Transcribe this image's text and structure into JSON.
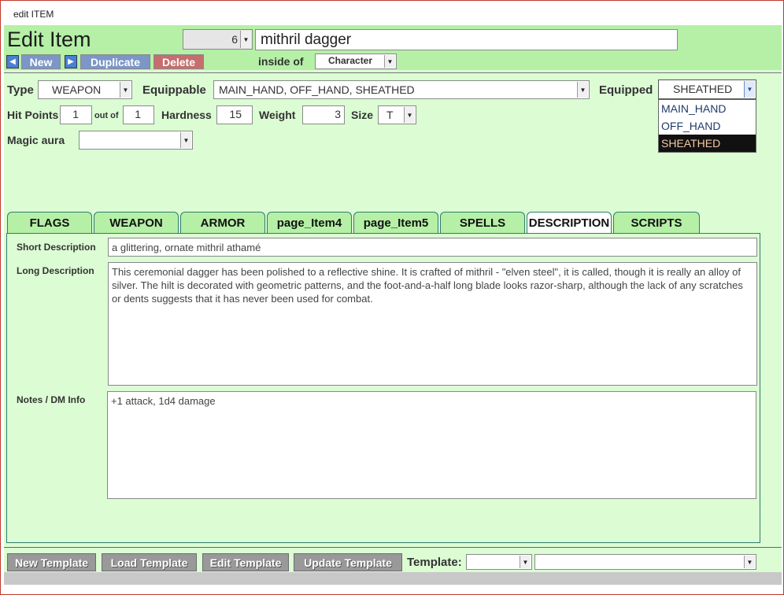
{
  "window": {
    "title": "edit ITEM"
  },
  "header": {
    "title": "Edit Item",
    "record_number": "6",
    "item_name": "mithril dagger",
    "new_label": "New",
    "duplicate_label": "Duplicate",
    "delete_label": "Delete",
    "inside_of_label": "inside of",
    "inside_of_value": "Character"
  },
  "fields": {
    "type_label": "Type",
    "type_value": "WEAPON",
    "equippable_label": "Equippable",
    "equippable_value": "MAIN_HAND, OFF_HAND, SHEATHED",
    "equipped_label": "Equipped",
    "equipped_value": "SHEATHED",
    "equipped_options": [
      "MAIN_HAND",
      "OFF_HAND",
      "SHEATHED"
    ],
    "hit_points_label": "Hit Points",
    "hit_points_value": "1",
    "out_of_label": "out of",
    "hit_points_max": "1",
    "hardness_label": "Hardness",
    "hardness_value": "15",
    "weight_label": "Weight",
    "weight_value": "3",
    "size_label": "Size",
    "size_value": "T",
    "magic_aura_label": "Magic aura",
    "magic_aura_value": ""
  },
  "tabs": [
    "FLAGS",
    "WEAPON",
    "ARMOR",
    "page_Item4",
    "page_Item5",
    "SPELLS",
    "DESCRIPTION",
    "SCRIPTS"
  ],
  "active_tab": "DESCRIPTION",
  "description": {
    "short_label": "Short Description",
    "short_value": "a glittering, ornate mithril athamé",
    "long_label": "Long Description",
    "long_value": "This ceremonial dagger has been polished to a reflective shine. It is crafted of mithril - \"elven steel\", it is called, though it is really an alloy of silver. The hilt is decorated with geometric patterns, and the foot-and-a-half long blade looks razor-sharp, although the lack of any scratches or dents suggests that it has never been used for combat.",
    "notes_label": "Notes / DM Info",
    "notes_value": "+1 attack, 1d4 damage"
  },
  "footer": {
    "new_template": "New Template",
    "load_template": "Load Template",
    "edit_template": "Edit Template",
    "update_template": "Update Template",
    "template_label": "Template:",
    "template_value_1": "",
    "template_value_2": ""
  },
  "icons": {
    "arrow": "▶",
    "arrow_left": "◀",
    "dropdown": "▼"
  }
}
